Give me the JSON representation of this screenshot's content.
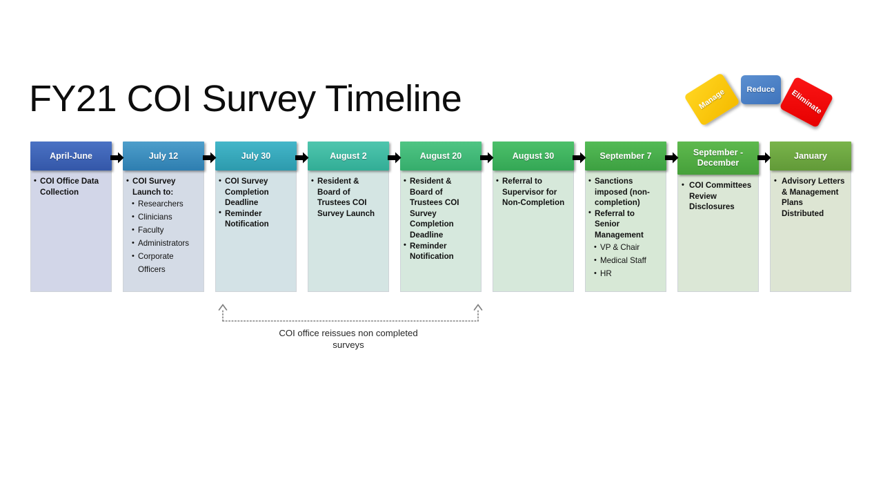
{
  "slide": {
    "title": "FY21 COI Survey Timeline"
  },
  "timeline": {
    "columns": [
      {
        "header": "April-June",
        "header_color_from": "#4a72c4",
        "header_color_to": "#3457a8",
        "body_color": "#d2d6e8",
        "bullets": [
          {
            "text": "COI Office Data Collection",
            "level": 1
          }
        ]
      },
      {
        "header": "July 12",
        "header_color_from": "#4d9ecb",
        "header_color_to": "#2e7eb0",
        "body_color": "#d4dbe6",
        "bullets": [
          {
            "text": "COI Survey Launch to:",
            "level": 1
          },
          {
            "text": "Researchers",
            "level": 2
          },
          {
            "text": "Clinicians",
            "level": 2
          },
          {
            "text": "Faculty",
            "level": 2
          },
          {
            "text": "Administrators",
            "level": 2
          },
          {
            "text": "Corporate Officers",
            "level": 2
          }
        ]
      },
      {
        "header": "July 30",
        "header_color_from": "#43b6c9",
        "header_color_to": "#2d9aad",
        "body_color": "#d3e2e6",
        "bullets": [
          {
            "text": "COI Survey Completion Deadline",
            "level": 1
          },
          {
            "text": "Reminder Notification",
            "level": 1
          }
        ]
      },
      {
        "header": "August 2",
        "header_color_from": "#4fc6ae",
        "header_color_to": "#32ad96",
        "body_color": "#d4e5e3",
        "bullets": [
          {
            "text": "Resident & Board of Trustees COI Survey Launch",
            "level": 1
          }
        ]
      },
      {
        "header": "August 20",
        "header_color_from": "#4fc584",
        "header_color_to": "#36ad6c",
        "body_color": "#d6e8dd",
        "bullets": [
          {
            "text": "Resident & Board of Trustees COI Survey Completion Deadline",
            "level": 1
          },
          {
            "text": "Reminder Notification",
            "level": 1
          }
        ]
      },
      {
        "header": "August 30",
        "header_color_from": "#4cc06a",
        "header_color_to": "#34a755",
        "body_color": "#d6e8da",
        "bullets": [
          {
            "text": "Referral to Supervisor for Non-Completion",
            "level": 1
          }
        ]
      },
      {
        "header": "September 7",
        "header_color_from": "#54bb56",
        "header_color_to": "#3da041",
        "body_color": "#d7e8d6",
        "bullets": [
          {
            "text": "Sanctions imposed (non-completion)",
            "level": 1
          },
          {
            "text": "Referral to Senior Management",
            "level": 1
          },
          {
            "text": "VP & Chair",
            "level": 2
          },
          {
            "text": "Medical Staff",
            "level": 2
          },
          {
            "text": "HR",
            "level": 2
          }
        ]
      },
      {
        "header": "September - December",
        "header_color_from": "#5eb94e",
        "header_color_to": "#46a03a",
        "body_color": "#dbe7d6",
        "two_line": true,
        "bullets": [
          {
            "text": "COI Committees Review Disclosures",
            "level": 1,
            "spaced": true
          }
        ]
      },
      {
        "header": "January",
        "header_color_from": "#79b44b",
        "header_color_to": "#629a38",
        "body_color": "#dde5d3",
        "bullets": [
          {
            "text": "Advisory Letters & Management Plans Distributed",
            "level": 1,
            "spaced": true
          }
        ]
      }
    ],
    "arrow_color": "#000000"
  },
  "annotation": {
    "caption": "COI office reissues non completed surveys",
    "line_color": "#808080"
  },
  "badges": [
    {
      "label": "Manage",
      "color_from": "#ffd41f",
      "color_to": "#f5bc00",
      "name": "manage"
    },
    {
      "label": "Reduce",
      "color_from": "#5b8fd0",
      "color_to": "#3f74bc",
      "name": "reduce"
    },
    {
      "label": "Eliminate",
      "color_from": "#fb1515",
      "color_to": "#e60000",
      "name": "eliminate"
    }
  ]
}
